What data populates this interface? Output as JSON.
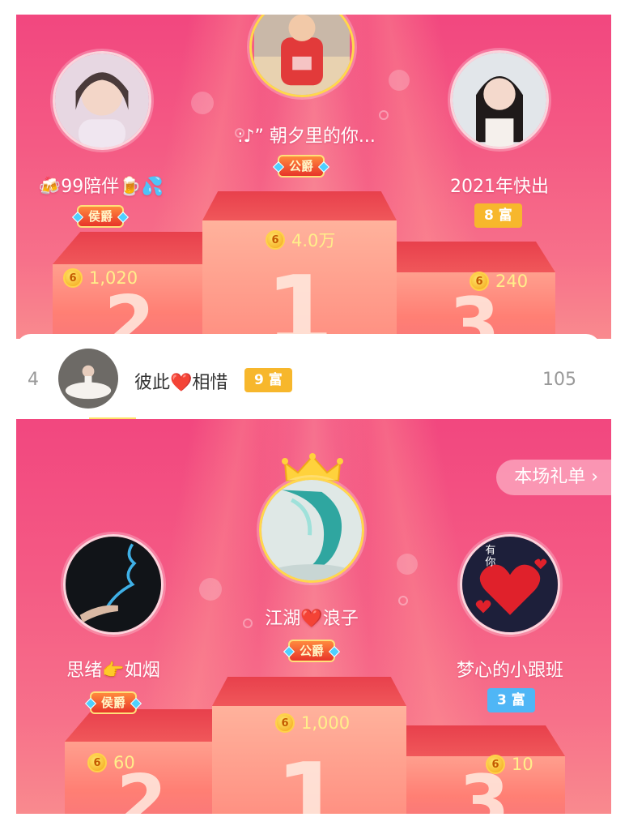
{
  "top_panel": {
    "first": {
      "name": " :♪” 朝夕里的你...",
      "title_badge": "公爵",
      "coins": "4.0万"
    },
    "second": {
      "name": "🍻99陪伴🍺💦",
      "title_badge": "侯爵",
      "coins": "1,020"
    },
    "third": {
      "name": "2021年快出",
      "rich_badge": "8 富",
      "coins": "240"
    },
    "coin_glyph": "6"
  },
  "row4": {
    "rank": "4",
    "name": "彼此❤️相惜",
    "rich_badge": "9 富",
    "score": "105"
  },
  "bottom_panel": {
    "gift_list_label": "本场礼单 ›",
    "first": {
      "name": "江湖❤️浪子",
      "title_badge": "公爵",
      "coins": "1,000"
    },
    "second": {
      "name": "思绪👉如烟",
      "title_badge": "侯爵",
      "coins": "60"
    },
    "third": {
      "name": "梦心的小跟班",
      "rich_badge": "3 富",
      "coins": "10"
    },
    "third_avatar_text": [
      "有",
      "你"
    ],
    "coin_glyph": "6"
  },
  "podium_numerals": {
    "first": "1",
    "second": "2",
    "third": "3"
  },
  "colors": {
    "panel_pink": "#f2477f",
    "coin_text": "#ffef8a",
    "rich_gold": "#f7b72c",
    "rich_blue": "#4fb6f6",
    "title_badge_red": "#e8342a"
  },
  "icons": [
    "coin-icon",
    "crown-icon",
    "chevron-right-icon"
  ]
}
